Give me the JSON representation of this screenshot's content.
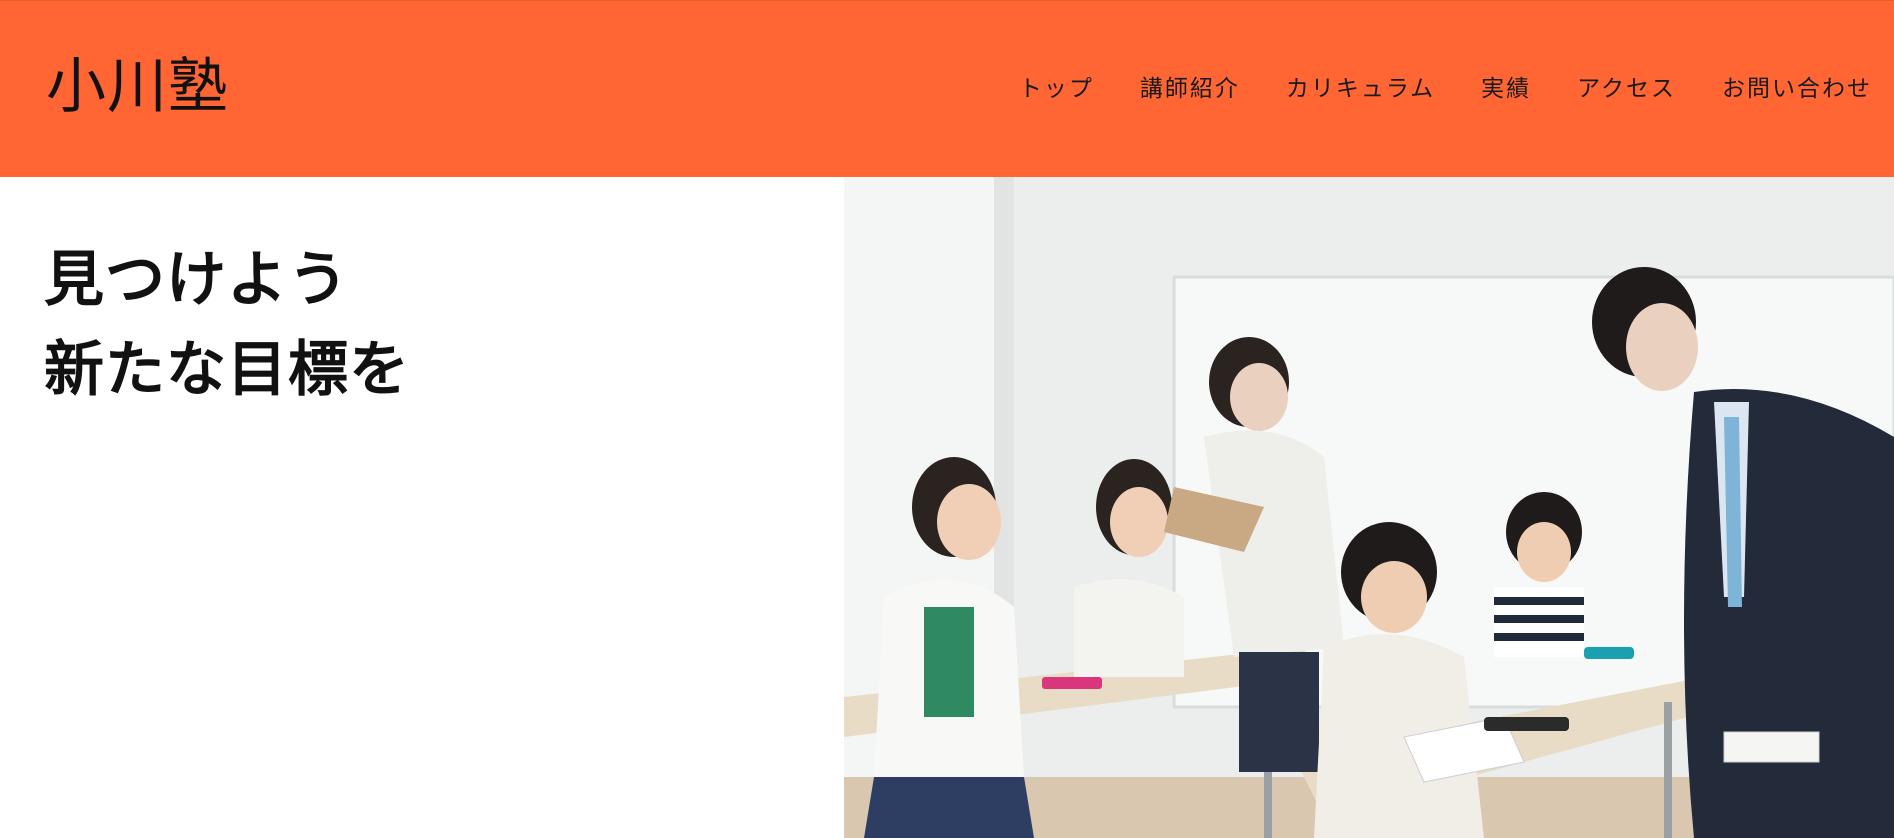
{
  "site": {
    "logo_text": "小川塾"
  },
  "nav": {
    "items": [
      {
        "label": "トップ"
      },
      {
        "label": "講師紹介"
      },
      {
        "label": "カリキュラム"
      },
      {
        "label": "実績"
      },
      {
        "label": "アクセス"
      },
      {
        "label": "お問い合わせ"
      }
    ]
  },
  "hero": {
    "headline_line1": "見つけよう",
    "headline_line2": "新たな目標を"
  },
  "colors": {
    "header_bg": "#ff6633",
    "text": "#111111",
    "page_bg": "#ffffff"
  }
}
